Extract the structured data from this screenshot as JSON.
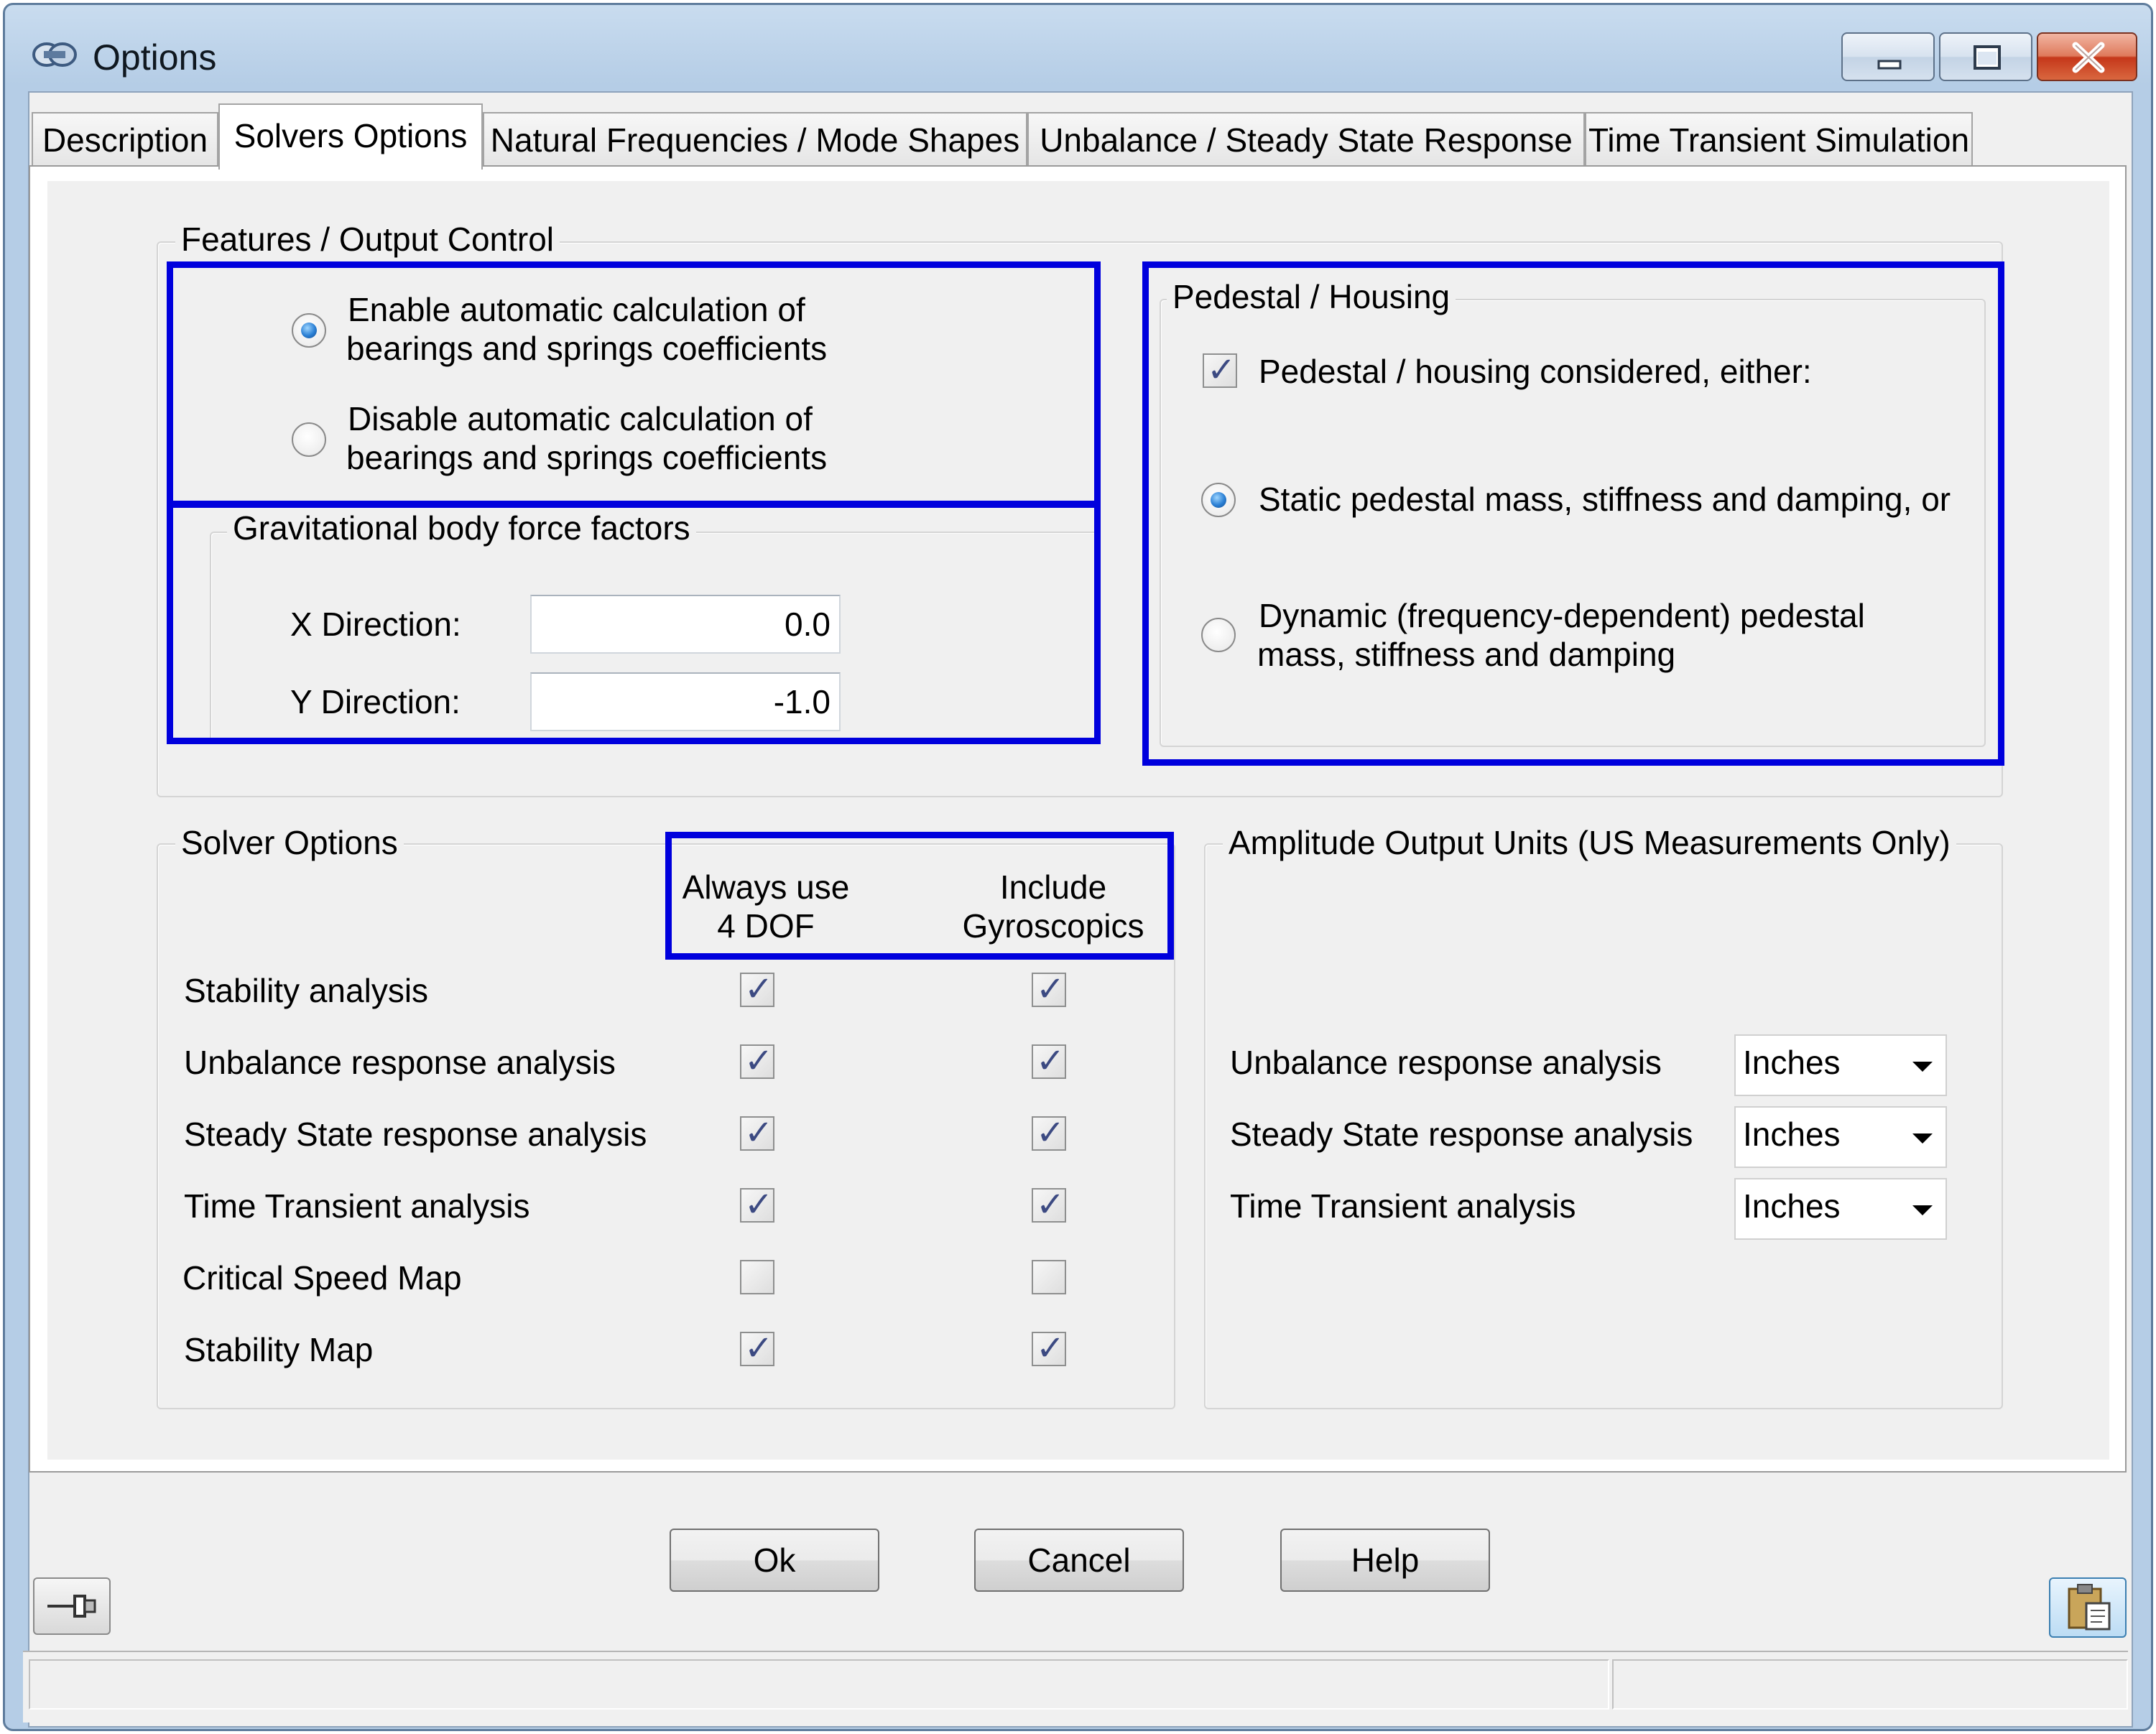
{
  "window": {
    "title": "Options"
  },
  "tabs": [
    {
      "label": "Description"
    },
    {
      "label": "Solvers Options",
      "active": true
    },
    {
      "label": "Natural Frequencies / Mode Shapes"
    },
    {
      "label": "Unbalance / Steady State Response"
    },
    {
      "label": "Time Transient Simulation"
    }
  ],
  "features": {
    "title": "Features / Output Control",
    "radio_enable": {
      "line1": "Enable automatic calculation of",
      "line2": "bearings and springs coefficients",
      "checked": true
    },
    "radio_disable": {
      "line1": "Disable automatic calculation of",
      "line2": "bearings and springs coefficients",
      "checked": false
    }
  },
  "gravity": {
    "title": "Gravitational body force factors",
    "x_label": "X Direction:",
    "x_value": "0.0",
    "y_label": "Y Direction:",
    "y_value": "-1.0"
  },
  "pedestal": {
    "title": "Pedestal / Housing",
    "considered_label": "Pedestal / housing considered, either:",
    "considered_checked": true,
    "static_label": "Static pedestal mass, stiffness and damping, or",
    "static_checked": true,
    "dynamic_line1": "Dynamic (frequency-dependent) pedestal",
    "dynamic_line2": "mass, stiffness and damping",
    "dynamic_checked": false
  },
  "solver_options": {
    "title": "Solver Options",
    "col1": {
      "line1": "Always use",
      "line2": "4 DOF"
    },
    "col2": {
      "line1": "Include",
      "line2": "Gyroscopics"
    },
    "rows": [
      {
        "label": "Stability analysis",
        "dof4": true,
        "gyro": true
      },
      {
        "label": "Unbalance response analysis",
        "dof4": true,
        "gyro": true
      },
      {
        "label": "Steady State response analysis",
        "dof4": true,
        "gyro": true
      },
      {
        "label": "Time Transient analysis",
        "dof4": true,
        "gyro": true
      },
      {
        "label": "Critical Speed Map",
        "dof4": false,
        "gyro": false
      },
      {
        "label": "Stability Map",
        "dof4": true,
        "gyro": true
      }
    ]
  },
  "amplitude_units": {
    "title": "Amplitude Output Units (US Measurements Only)",
    "rows": [
      {
        "label": "Unbalance response analysis",
        "value": "Inches"
      },
      {
        "label": "Steady State response analysis",
        "value": "Inches"
      },
      {
        "label": "Time Transient analysis",
        "value": "Inches"
      }
    ]
  },
  "buttons": {
    "ok": "Ok",
    "cancel": "Cancel",
    "help": "Help"
  },
  "icons": {
    "title": "options-gears-icon",
    "minimize": "minimize-icon",
    "maximize": "maximize-icon",
    "close": "close-icon",
    "pin": "pin-icon",
    "clipboard": "clipboard-icon"
  },
  "colors": {
    "highlight": "#0000dd",
    "close_button": "#c5371a",
    "radio_dot": "#2a7fd4"
  }
}
